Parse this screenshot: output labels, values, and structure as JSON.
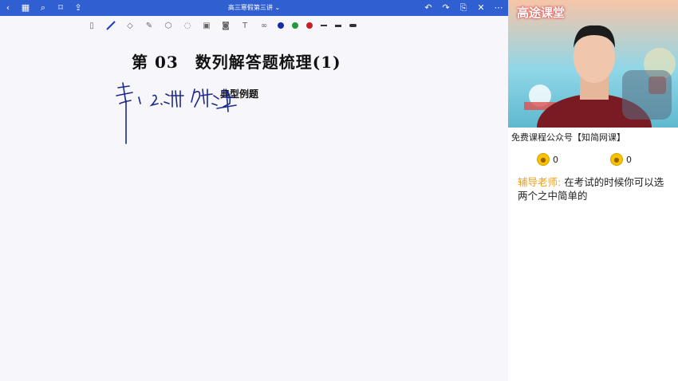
{
  "topbar": {
    "title": "高三寒假第三讲",
    "title_caret": "⌄",
    "left_icons": [
      "back-icon",
      "grid-icon",
      "search-icon",
      "bookmark-icon",
      "share-icon"
    ],
    "right_icons": [
      "undo-icon",
      "redo-icon",
      "export-icon",
      "close-icon",
      "more-icon"
    ]
  },
  "toolbar": {
    "tools": [
      "reader-mode-icon",
      "pen-icon",
      "eraser-icon",
      "highlighter-icon",
      "shapes-icon",
      "lasso-icon",
      "image-icon",
      "camera-icon",
      "text-icon",
      "link-icon"
    ],
    "colors": [
      "#1a2aa8",
      "#1f9a3a",
      "#c8202a"
    ],
    "stroke_widths": [
      "thin",
      "medium",
      "thick"
    ]
  },
  "page": {
    "heading": "第 03　数列解答题梳理(1)",
    "subheading": "典型例题",
    "handwriting": "第1 2.讲 解消题"
  },
  "video": {
    "brand": "高途课堂"
  },
  "sidebar": {
    "promo": "免费课程公众号【知简网课】",
    "coin_left": "0",
    "coin_right": "0",
    "chat_author": "辅导老师:",
    "chat_text": "在考试的时候你可以选两个之中简单的"
  }
}
